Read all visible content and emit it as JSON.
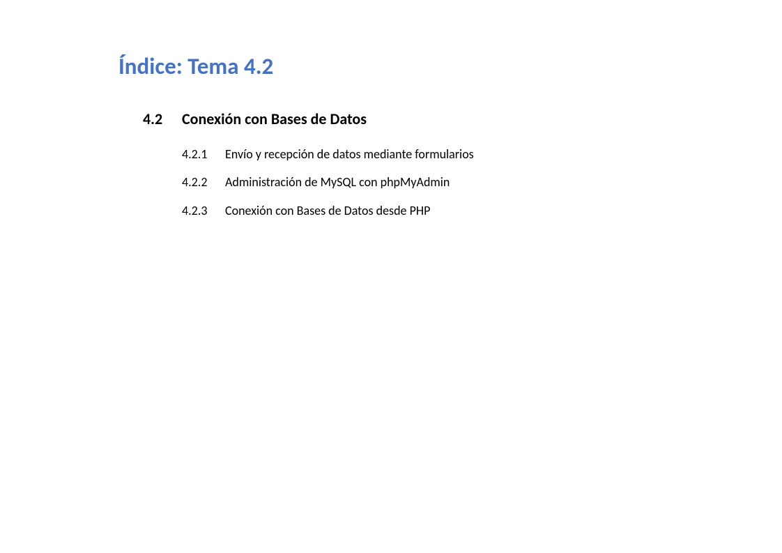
{
  "title": "Índice: Tema 4.2",
  "section": {
    "number": "4.2",
    "label": "Conexión con Bases de Datos"
  },
  "subsections": [
    {
      "number": "4.2.1",
      "label": "Envío y recepción de datos mediante formularios"
    },
    {
      "number": "4.2.2",
      "label": "Administración de MySQL con phpMyAdmin"
    },
    {
      "number": "4.2.3",
      "label": "Conexión con Bases de Datos desde PHP"
    }
  ]
}
